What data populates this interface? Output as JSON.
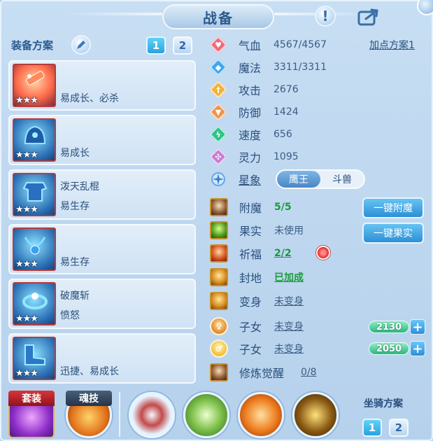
{
  "title": "战备",
  "left": {
    "plan_label": "装备方案",
    "tabs": [
      "1",
      "2"
    ],
    "cards": [
      {
        "line1": "",
        "line2": "易成长、必杀",
        "stars": "★★★"
      },
      {
        "line1": "",
        "line2": "易成长",
        "stars": "★★★"
      },
      {
        "line1": "泼天乱棍",
        "line2": "易生存",
        "stars": "★★★"
      },
      {
        "line1": "",
        "line2": "易生存",
        "stars": "★★★"
      },
      {
        "line1": "破魔斩",
        "line2": "愤怒",
        "stars": "★★★"
      },
      {
        "line1": "",
        "line2": "迅捷、易成长",
        "stars": "★★★"
      }
    ]
  },
  "stats": {
    "add_point_plan": "加点方案1",
    "hp": {
      "name": "气血",
      "value": "4567/4567"
    },
    "mp": {
      "name": "魔法",
      "value": "3311/3311"
    },
    "atk": {
      "name": "攻击",
      "value": "2676"
    },
    "def": {
      "name": "防御",
      "value": "1424"
    },
    "spd": {
      "name": "速度",
      "value": "656"
    },
    "spirit": {
      "name": "灵力",
      "value": "1095"
    },
    "star": {
      "name": "星象",
      "options": [
        "鹰王",
        "斗兽"
      ],
      "selected": "鹰王"
    }
  },
  "extras": {
    "enchant": {
      "name": "附魔",
      "value": "5/5",
      "button": "一键附魔"
    },
    "fruit": {
      "name": "果实",
      "value": "未使用",
      "button": "一键果实"
    },
    "bless": {
      "name": "祈福",
      "value": "2/2"
    },
    "seal": {
      "name": "封地",
      "value": "已加成"
    },
    "transform": {
      "name": "变身",
      "value": "未变身"
    },
    "child1": {
      "name": "子女",
      "value": "未变身",
      "exp": "2130"
    },
    "child2": {
      "name": "子女",
      "value": "未变身",
      "exp": "2050"
    },
    "cultivate": {
      "name": "修炼觉醒",
      "value": "0/8"
    }
  },
  "bottom": {
    "suit_label": "套装",
    "soul_label": "魂技",
    "mount_label": "坐骑方案",
    "mount_tabs": [
      "1",
      "2"
    ]
  },
  "colors": {
    "accent": "#2aa3e1",
    "value_green": "#1b9a3c",
    "text_primary": "#2a4f7d"
  }
}
